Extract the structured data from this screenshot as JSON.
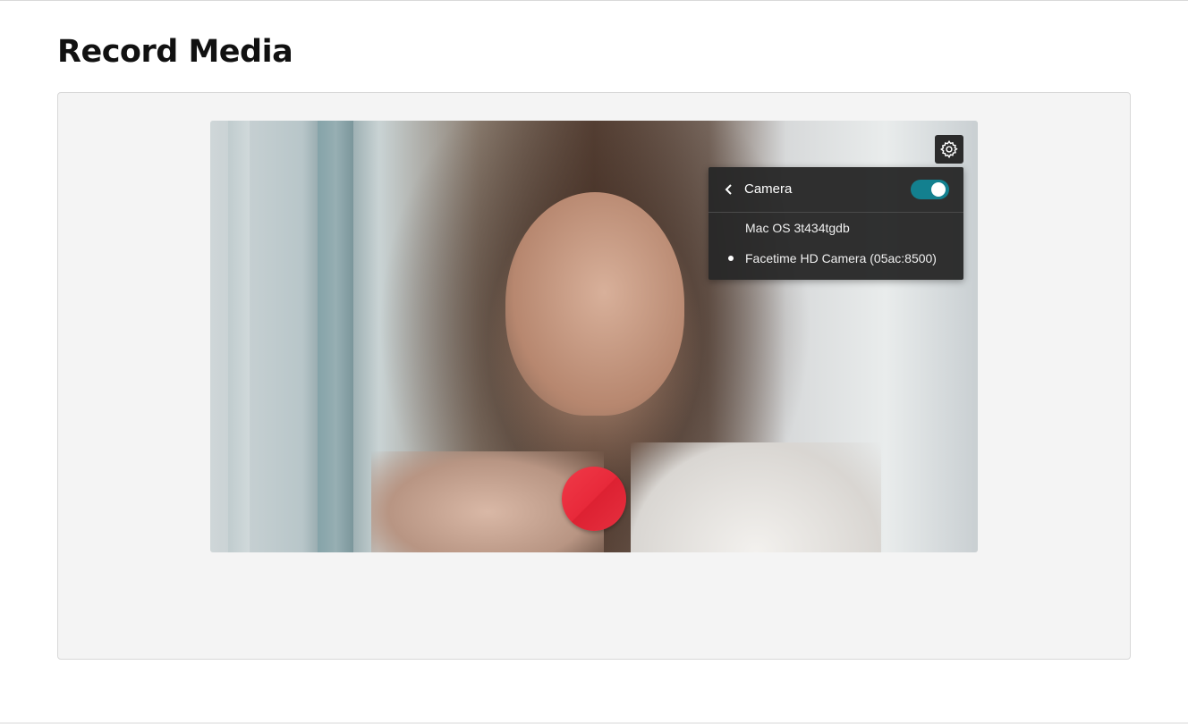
{
  "page": {
    "title": "Record Media"
  },
  "recorder": {
    "preview_image": "woman-webcam-preview",
    "settings_icon": "gear-icon",
    "record_icon": "record-icon",
    "record_color": "#e8293a"
  },
  "camera_menu": {
    "title": "Camera",
    "back_icon": "chevron-left-icon",
    "toggle_on": true,
    "toggle_color": "#13808f",
    "options": [
      {
        "label": "Mac OS 3t434tgdb",
        "selected": false
      },
      {
        "label": "Facetime HD Camera (05ac:8500)",
        "selected": true
      }
    ]
  }
}
